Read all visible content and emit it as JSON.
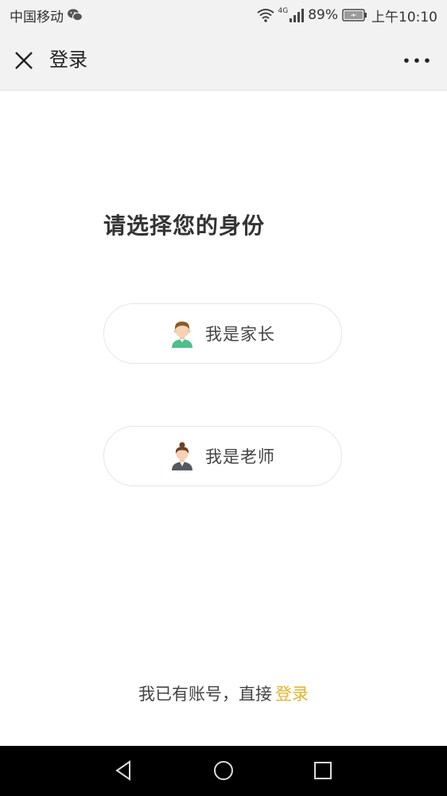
{
  "status_bar": {
    "carrier": "中国移动",
    "network": "4G",
    "battery": "89%",
    "time": "上午10:10",
    "icons": [
      "wechat-icon",
      "wifi-icon",
      "signal-icon",
      "battery-charging-icon"
    ]
  },
  "header": {
    "title": "登录",
    "close_icon": "close-icon",
    "more_icon": "more-icon"
  },
  "main": {
    "prompt": "请选择您的身份",
    "roles": [
      {
        "label": "我是家长",
        "icon": "parent-avatar-icon"
      },
      {
        "label": "我是老师",
        "icon": "teacher-avatar-icon"
      }
    ]
  },
  "footer": {
    "text": "我已有账号，直接",
    "login_link": "登录",
    "link_color": "#e4b32c"
  },
  "nav_bar": {
    "icons": [
      "back-triangle-icon",
      "home-circle-icon",
      "recent-square-icon"
    ]
  }
}
